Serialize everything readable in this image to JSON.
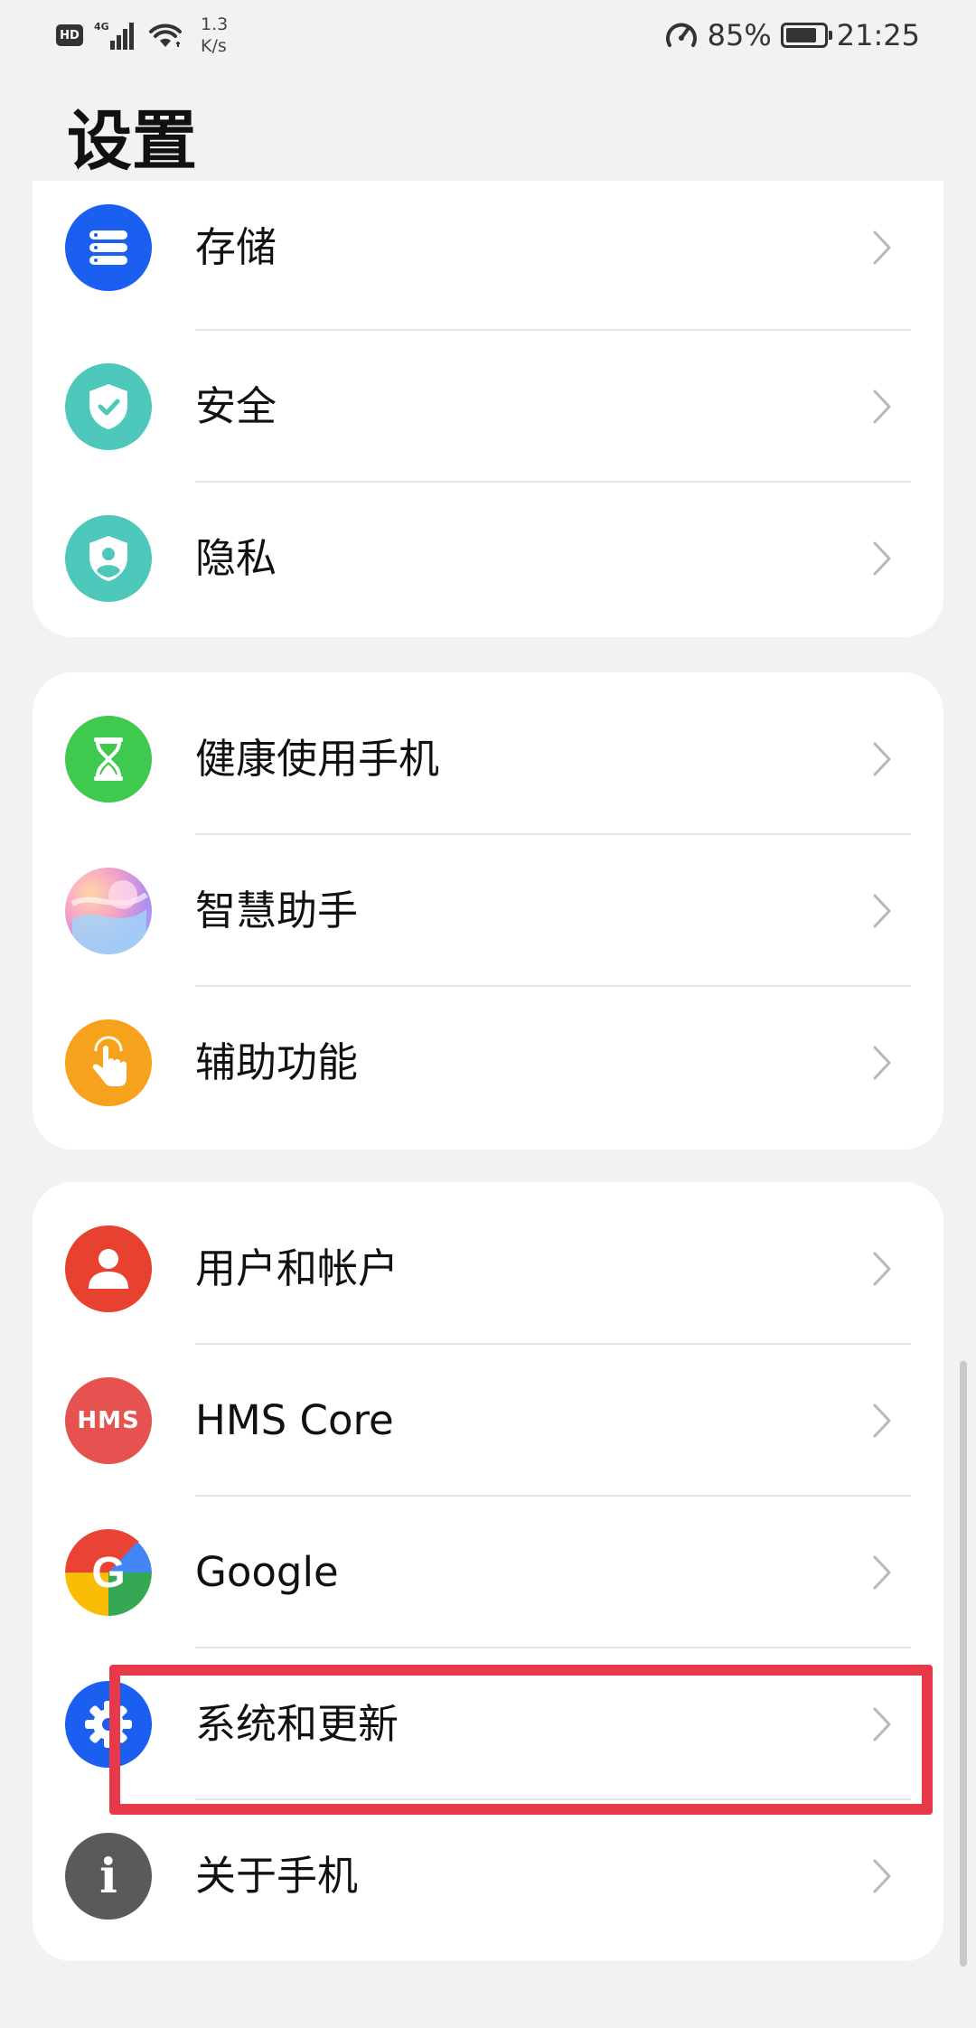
{
  "status_bar": {
    "hd": "HD",
    "network": "4G",
    "speed_value": "1.3",
    "speed_unit": "K/s",
    "battery_percent": "85%",
    "battery_level": 0.85,
    "time": "21:25"
  },
  "page": {
    "title": "设置"
  },
  "groups": [
    {
      "items": [
        {
          "label": "存储",
          "icon": "storage-icon",
          "color": "#1a5ff0"
        },
        {
          "label": "安全",
          "icon": "security-shield-icon",
          "color": "#4fc8bc"
        },
        {
          "label": "隐私",
          "icon": "privacy-shield-icon",
          "color": "#4fc8bc"
        }
      ]
    },
    {
      "items": [
        {
          "label": "健康使用手机",
          "icon": "hourglass-icon",
          "color": "#3fca4f"
        },
        {
          "label": "智慧助手",
          "icon": "smart-assistant-icon",
          "color": "#d68ae0"
        },
        {
          "label": "辅助功能",
          "icon": "accessibility-hand-icon",
          "color": "#f7a21c"
        }
      ]
    },
    {
      "items": [
        {
          "label": "用户和帐户",
          "icon": "user-icon",
          "color": "#e9412f"
        },
        {
          "label": "HMS Core",
          "icon": "hms-core-icon",
          "color": "#e5524f",
          "icon_text": "HMS"
        },
        {
          "label": "Google",
          "icon": "google-icon",
          "color": "#ffffff",
          "icon_text": "G"
        },
        {
          "label": "系统和更新",
          "icon": "gear-icon",
          "color": "#1a5ff0"
        },
        {
          "label": "关于手机",
          "icon": "info-icon",
          "color": "#5a5a5a",
          "icon_text": "i"
        }
      ]
    }
  ],
  "highlight": {
    "color": "#e8394a",
    "target": "系统和更新"
  }
}
